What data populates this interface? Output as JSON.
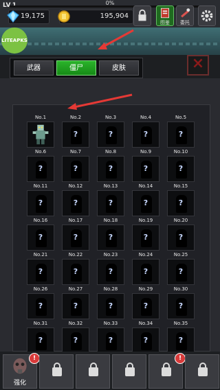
{
  "header": {
    "level": "LV.1",
    "progress_text": "0%",
    "progress": 0,
    "gems": "19,175",
    "coins": "195,904",
    "buttons": [
      {
        "label": "",
        "icon": "lock-icon"
      },
      {
        "label": "图鉴",
        "icon": "book-icon"
      },
      {
        "label": "委托",
        "icon": "wrench-icon"
      },
      {
        "label": "",
        "icon": "gear-icon"
      }
    ]
  },
  "watermark": "LITEAPKS",
  "tabs": [
    {
      "label": "武器"
    },
    {
      "label": "僵尸"
    },
    {
      "label": "皮肤"
    }
  ],
  "active_tab": "僵尸",
  "close_icon": "close-icon",
  "grid": {
    "unlocked_first": true,
    "items": [
      {
        "label": "No.1"
      },
      {
        "label": "No.2"
      },
      {
        "label": "No.3"
      },
      {
        "label": "No.4"
      },
      {
        "label": "No.5"
      },
      {
        "label": "No.6"
      },
      {
        "label": "No.7"
      },
      {
        "label": "No.8"
      },
      {
        "label": "No.9"
      },
      {
        "label": "No.10"
      },
      {
        "label": "No.11"
      },
      {
        "label": "No.12"
      },
      {
        "label": "No.13"
      },
      {
        "label": "No.14"
      },
      {
        "label": "No.15"
      },
      {
        "label": "No.16"
      },
      {
        "label": "No.17"
      },
      {
        "label": "No.18"
      },
      {
        "label": "No.19"
      },
      {
        "label": "No.20"
      },
      {
        "label": "No.21"
      },
      {
        "label": "No.22"
      },
      {
        "label": "No.23"
      },
      {
        "label": "No.24"
      },
      {
        "label": "No.25"
      },
      {
        "label": "No.26"
      },
      {
        "label": "No.27"
      },
      {
        "label": "No.28"
      },
      {
        "label": "No.29"
      },
      {
        "label": "No.30"
      },
      {
        "label": "No.31"
      },
      {
        "label": "No.32"
      },
      {
        "label": "No.33"
      },
      {
        "label": "No.34"
      },
      {
        "label": "No.35"
      }
    ]
  },
  "bottom": {
    "slots": [
      {
        "label": "强化",
        "locked": false,
        "badge": "!"
      },
      {
        "label": "",
        "locked": true
      },
      {
        "label": "",
        "locked": true
      },
      {
        "label": "",
        "locked": true
      },
      {
        "label": "",
        "locked": true,
        "badge": "!"
      },
      {
        "label": "",
        "locked": true
      }
    ]
  },
  "colors": {
    "accent": "#2bb42b",
    "annotation": "#e53935",
    "badge": "#d83a3a"
  }
}
